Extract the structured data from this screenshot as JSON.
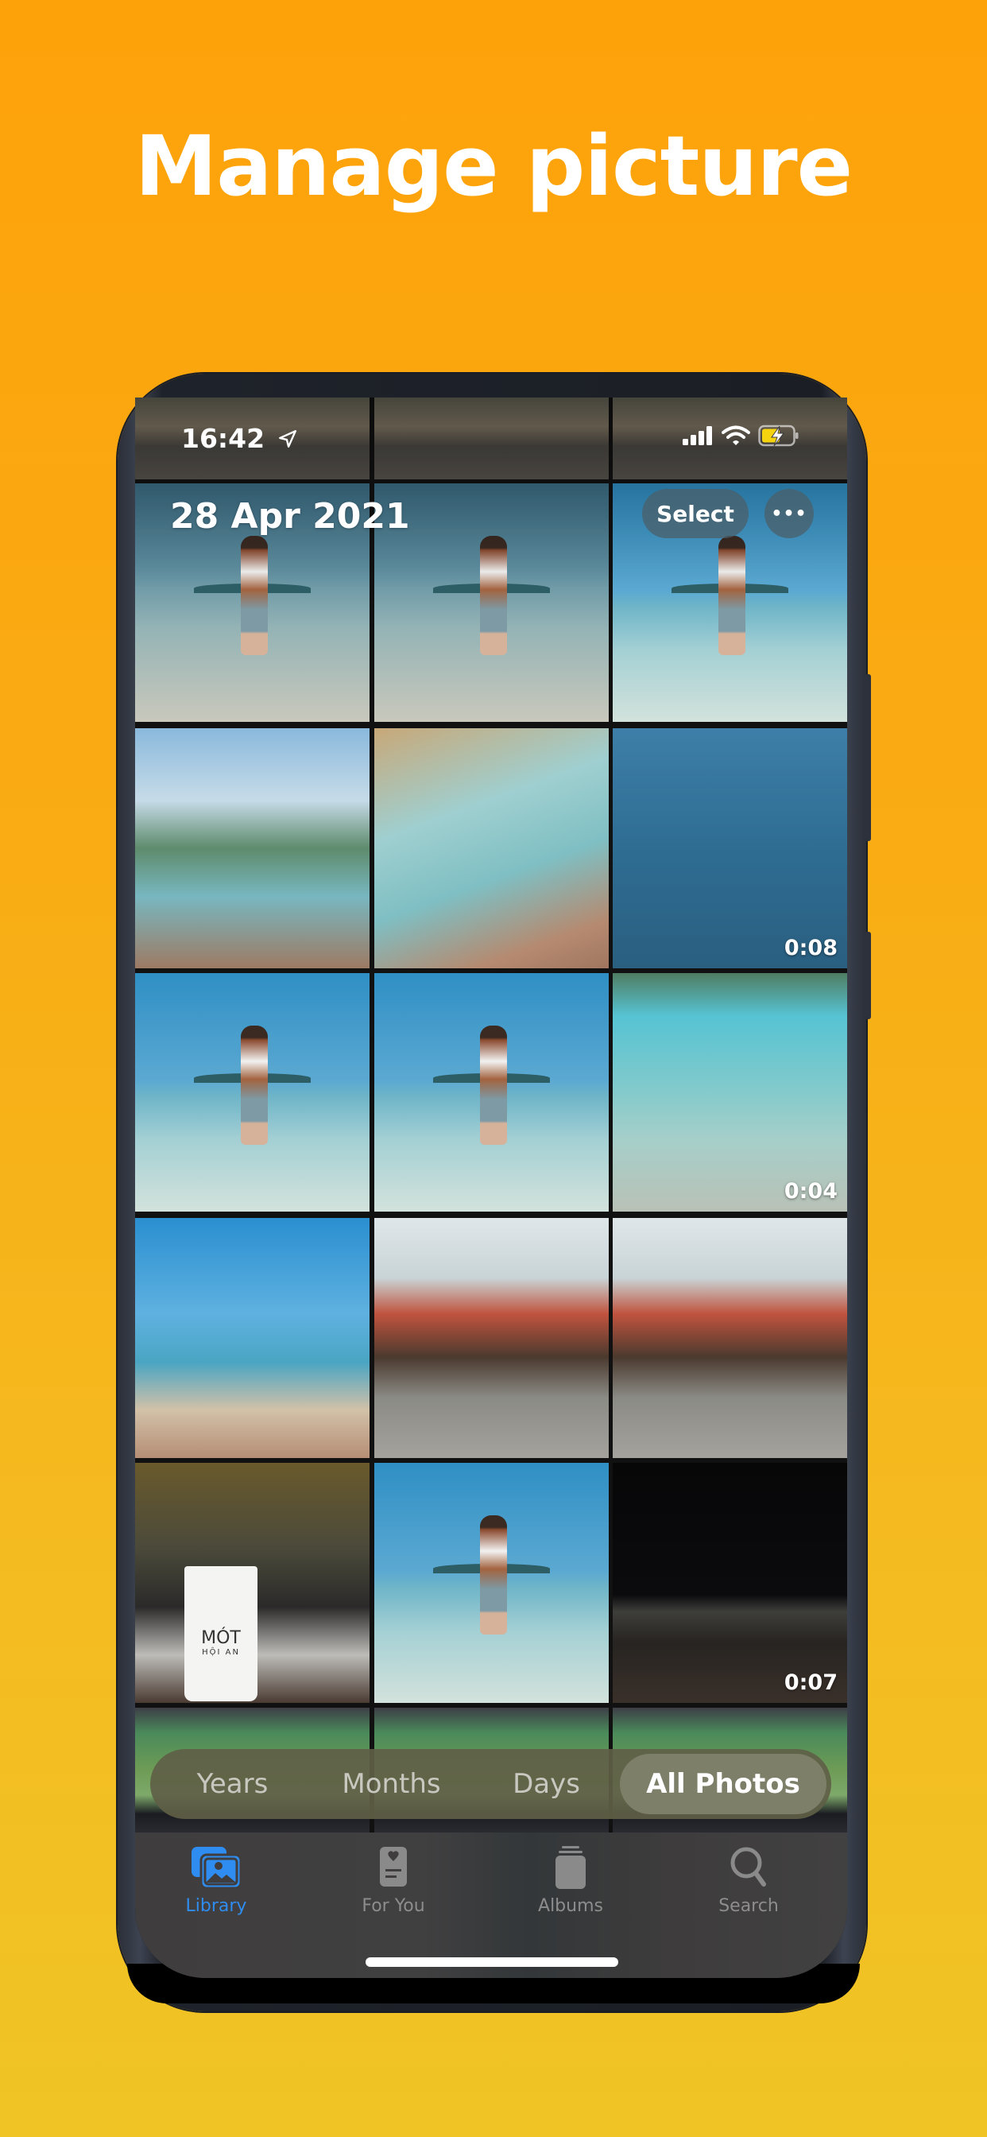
{
  "promo": {
    "headline": "Manage picture"
  },
  "status_bar": {
    "time": "16:42",
    "location_icon": "location-arrow-icon",
    "signal_icon": "cellular-signal-icon",
    "wifi_icon": "wifi-icon",
    "battery_icon": "battery-charging-icon",
    "battery_color": "#F5D40F"
  },
  "header": {
    "date_title": "28 Apr 2021",
    "select_label": "Select",
    "more_label": "•••"
  },
  "grid": {
    "rows": [
      [
        {
          "type": "photo",
          "desc": "rocks-beach"
        },
        {
          "type": "photo",
          "desc": "rocks-beach"
        },
        {
          "type": "photo",
          "desc": "rocks-beach"
        }
      ],
      [
        {
          "type": "photo",
          "desc": "man-beach-hat"
        },
        {
          "type": "photo",
          "desc": "man-beach-waves"
        },
        {
          "type": "photo",
          "desc": "man-beach"
        }
      ],
      [
        {
          "type": "photo",
          "desc": "selfie-hat-left"
        },
        {
          "type": "photo",
          "desc": "selfie-hat-right"
        },
        {
          "type": "video",
          "desc": "swimmer-sea",
          "duration": "0:08"
        }
      ],
      [
        {
          "type": "photo",
          "desc": "man-beach"
        },
        {
          "type": "photo",
          "desc": "man-beach"
        },
        {
          "type": "video",
          "desc": "rock-clear-water",
          "duration": "0:04"
        }
      ],
      [
        {
          "type": "photo",
          "desc": "beach-chairs-hand"
        },
        {
          "type": "photo",
          "desc": "hoi-an-bridge"
        },
        {
          "type": "photo",
          "desc": "hoi-an-bridge"
        }
      ],
      [
        {
          "type": "photo",
          "desc": "mot-hoi-an-drink",
          "cup_brand": "MÓT",
          "cup_sub": "HỘI AN"
        },
        {
          "type": "photo",
          "desc": "man-beach"
        },
        {
          "type": "video",
          "desc": "night-beach",
          "duration": "0:07"
        }
      ],
      [
        {
          "type": "photo",
          "desc": "plane-map"
        },
        {
          "type": "photo",
          "desc": "plane-map"
        },
        {
          "type": "photo",
          "desc": "plane-map"
        }
      ]
    ]
  },
  "view_switcher": {
    "options": [
      "Years",
      "Months",
      "Days",
      "All Photos"
    ],
    "selected": "All Photos"
  },
  "tab_bar": {
    "accent_color": "#2F8CF0",
    "items": [
      {
        "label": "Library",
        "icon": "photo-library-icon",
        "active": true
      },
      {
        "label": "For You",
        "icon": "for-you-icon",
        "active": false
      },
      {
        "label": "Albums",
        "icon": "albums-icon",
        "active": false
      },
      {
        "label": "Search",
        "icon": "search-icon",
        "active": false
      }
    ]
  }
}
